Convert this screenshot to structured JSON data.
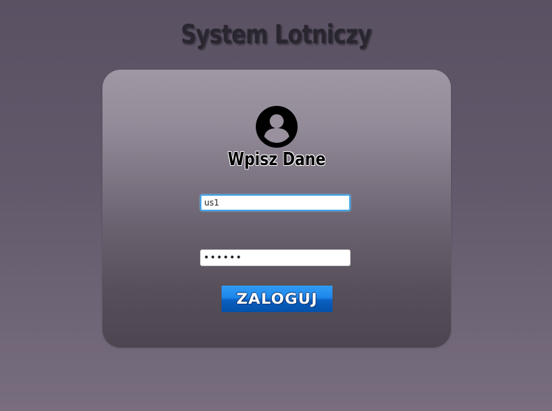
{
  "header": {
    "title": "System Lotniczy"
  },
  "login_card": {
    "icon": "user-circle-icon",
    "heading": "Wpisz Dane",
    "username": {
      "value": "us1"
    },
    "password": {
      "value": "••••••"
    },
    "submit_label": "ZALOGUJ"
  },
  "colors": {
    "button_blue": "#1f86ea",
    "focus_border": "#43a5e8"
  }
}
